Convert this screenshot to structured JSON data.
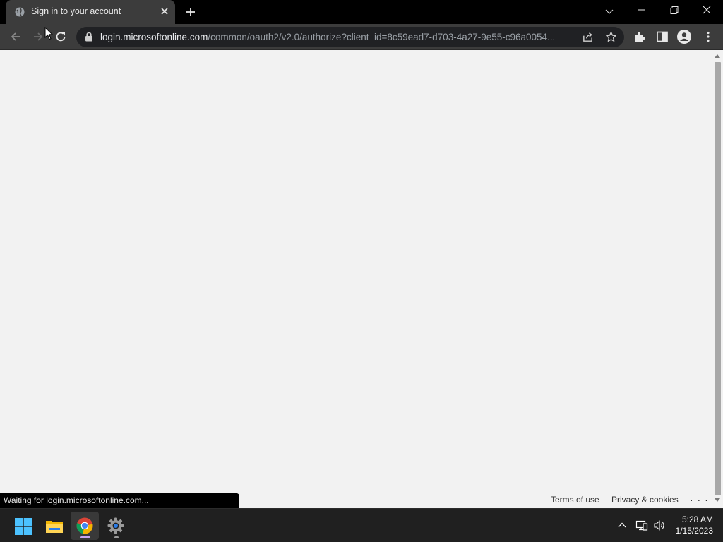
{
  "browser": {
    "tab": {
      "title": "Sign in to your account",
      "favicon": "globe-icon"
    },
    "address_bar": {
      "host": "login.microsoftonline.com",
      "path": "/common/oauth2/v2.0/authorize?client_id=8c59ead7-d703-4a27-9e55-c96a0054..."
    },
    "status_text": "Waiting for login.microsoftonline.com..."
  },
  "page": {
    "footer": {
      "terms": "Terms of use",
      "privacy": "Privacy & cookies",
      "more": "· · ·"
    }
  },
  "taskbar": {
    "apps": [
      "windows-start-icon",
      "file-explorer-icon",
      "chrome-icon",
      "settings-icon"
    ],
    "time": "5:28 AM",
    "date": "1/15/2023"
  },
  "colors": {
    "tab_bg": "#3c3c3c",
    "tabstrip_bg": "#000000",
    "page_bg": "#f2f2f2",
    "taskbar_bg": "#202020"
  }
}
